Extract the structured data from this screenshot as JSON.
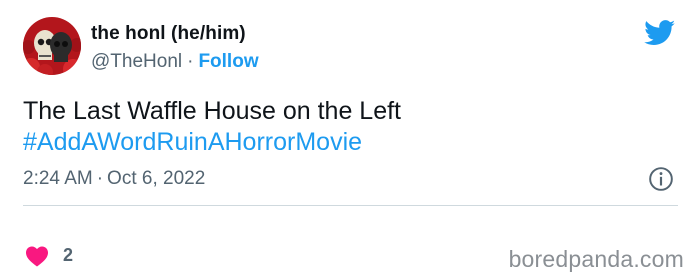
{
  "author": {
    "name": "the honl (he/him)",
    "handle": "@TheHonl",
    "separator": "·",
    "follow_label": "Follow"
  },
  "tweet": {
    "text": "The Last Waffle House on the Left",
    "hashtag": "#AddAWordRuinAHorrorMovie"
  },
  "meta": {
    "time": "2:24 AM",
    "separator": "·",
    "date": "Oct 6, 2022"
  },
  "engagement": {
    "likes": "2"
  },
  "watermark": "boredpanda.com",
  "icons": {
    "brand": "twitter-bird-icon",
    "info": "info-icon",
    "like": "heart-icon"
  },
  "colors": {
    "accent": "#1d9bf0",
    "like": "#f91880",
    "secondary_text": "#536471"
  }
}
